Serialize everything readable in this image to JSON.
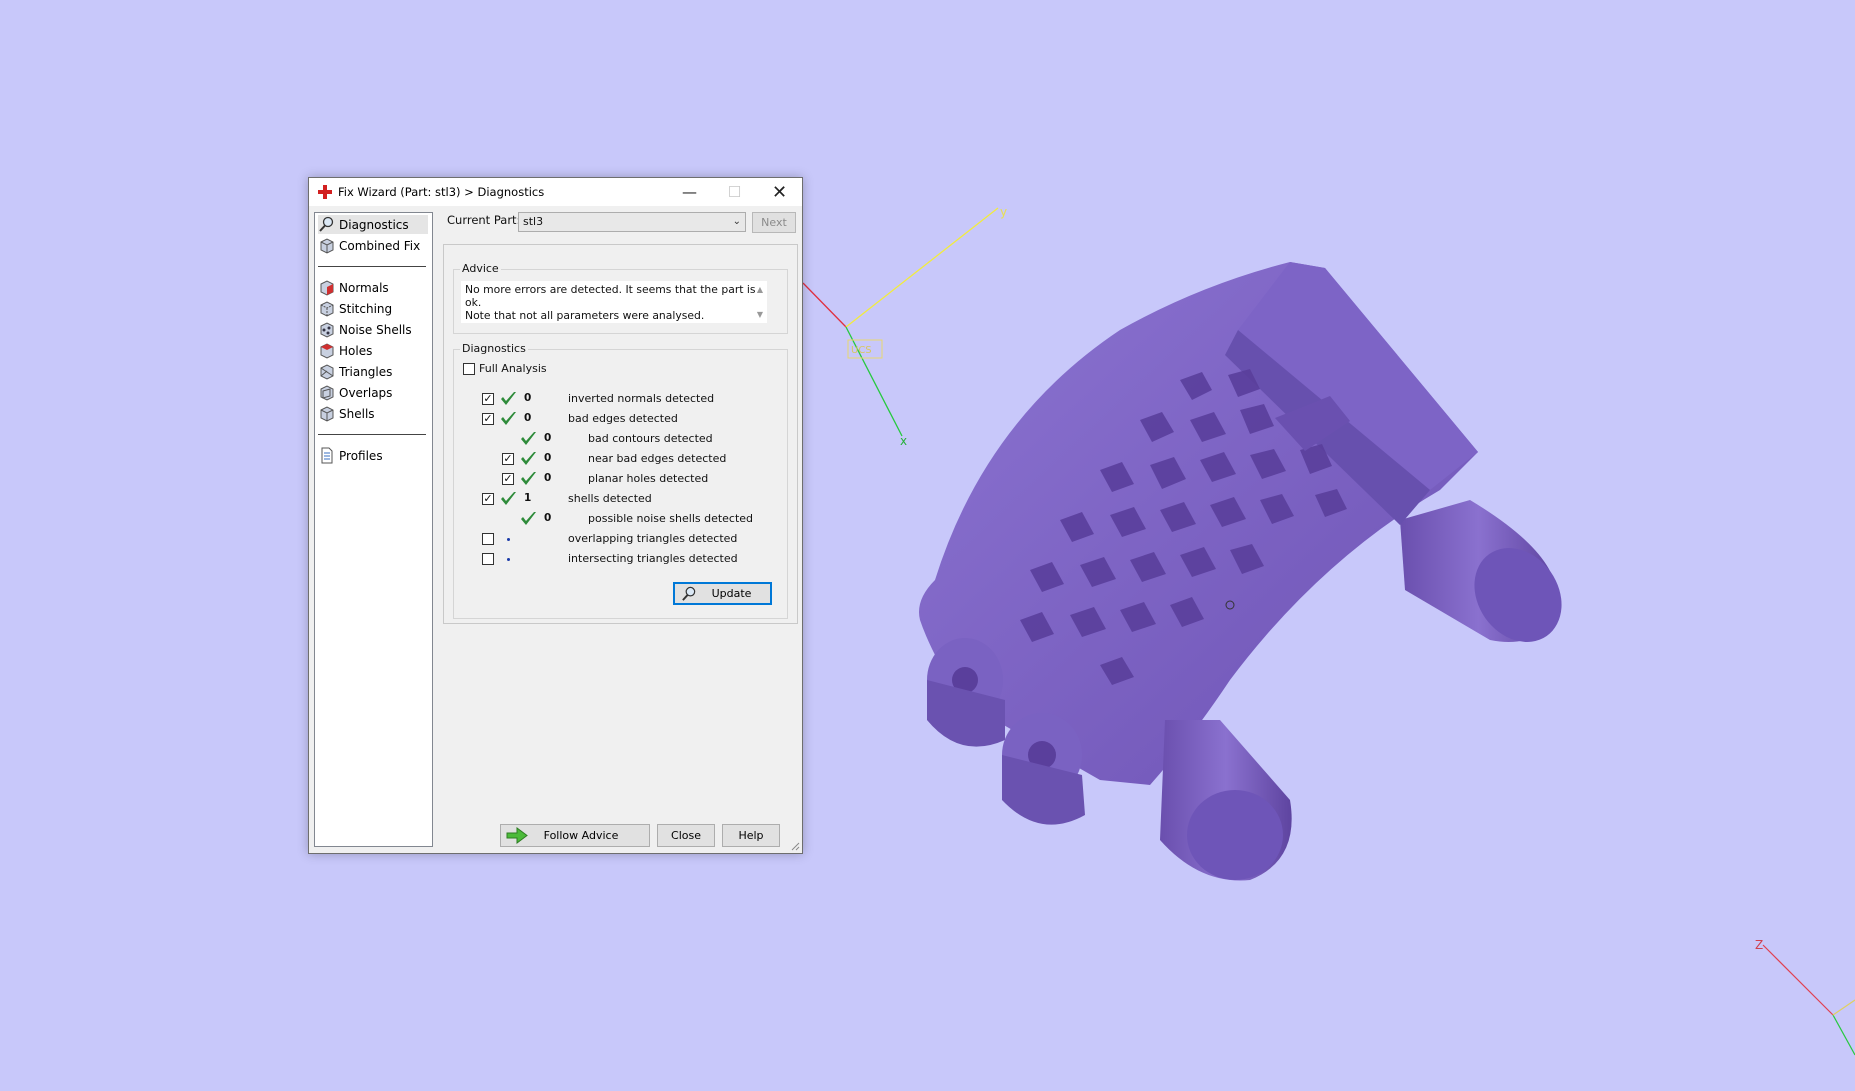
{
  "window": {
    "title": "Fix Wizard (Part: stl3) > Diagnostics",
    "minimize_glyph": "—",
    "maximize_glyph": "☐",
    "close_glyph": "✕",
    "icon": "red-cross-icon"
  },
  "sidebar": {
    "items": [
      {
        "label": "Diagnostics",
        "icon": "magnifier-icon"
      },
      {
        "label": "Combined Fix",
        "icon": "cube-icon"
      },
      {
        "label": "Normals",
        "icon": "cube-red-face-icon"
      },
      {
        "label": "Stitching",
        "icon": "cube-stitch-icon"
      },
      {
        "label": "Noise Shells",
        "icon": "cube-dots-icon"
      },
      {
        "label": "Holes",
        "icon": "cube-hole-icon"
      },
      {
        "label": "Triangles",
        "icon": "cube-triangles-icon"
      },
      {
        "label": "Overlaps",
        "icon": "cube-overlap-icon"
      },
      {
        "label": "Shells",
        "icon": "cube-shells-icon"
      },
      {
        "label": "Profiles",
        "icon": "document-icon"
      }
    ]
  },
  "current_part": {
    "label": "Current Part:",
    "value": "stl3",
    "next_label": "Next"
  },
  "advice": {
    "heading": "Advice",
    "line1": "No more errors are detected. It seems that the part is ok.",
    "line2": "Note that not all parameters were analysed."
  },
  "diagnostics": {
    "heading": "Diagnostics",
    "full_analysis_label": "Full Analysis",
    "full_analysis_checked": false,
    "rows": [
      {
        "checkbox": true,
        "checked": true,
        "status": "ok",
        "count": "0",
        "text": "inverted normals detected"
      },
      {
        "checkbox": true,
        "checked": true,
        "status": "ok",
        "count": "0",
        "text": "bad edges detected"
      },
      {
        "checkbox": false,
        "checked": false,
        "status": "ok",
        "count": "0",
        "text": "bad contours detected"
      },
      {
        "checkbox": true,
        "checked": true,
        "status": "ok",
        "count": "0",
        "text": "near bad edges detected"
      },
      {
        "checkbox": true,
        "checked": true,
        "status": "ok",
        "count": "0",
        "text": "planar holes detected"
      },
      {
        "checkbox": true,
        "checked": true,
        "status": "ok",
        "count": "1",
        "text": "shells detected"
      },
      {
        "checkbox": false,
        "checked": false,
        "status": "ok",
        "count": "0",
        "text": "possible noise shells detected"
      },
      {
        "checkbox": true,
        "checked": false,
        "status": "pending",
        "count": "",
        "text": "overlapping triangles detected"
      },
      {
        "checkbox": true,
        "checked": false,
        "status": "pending",
        "count": "",
        "text": "intersecting triangles detected"
      }
    ],
    "update_label": "Update"
  },
  "footer": {
    "follow_advice_label": "Follow Advice",
    "close_label": "Close",
    "help_label": "Help"
  },
  "axes": {
    "y_label": "y",
    "x_label": "x",
    "z_label": "Z",
    "ucs_label": "UCS"
  },
  "colors": {
    "viewport_bg": "#c8c8fa",
    "model": "#7b62c0",
    "check_green": "#2e8b3a",
    "focus_blue": "#0078d7"
  }
}
